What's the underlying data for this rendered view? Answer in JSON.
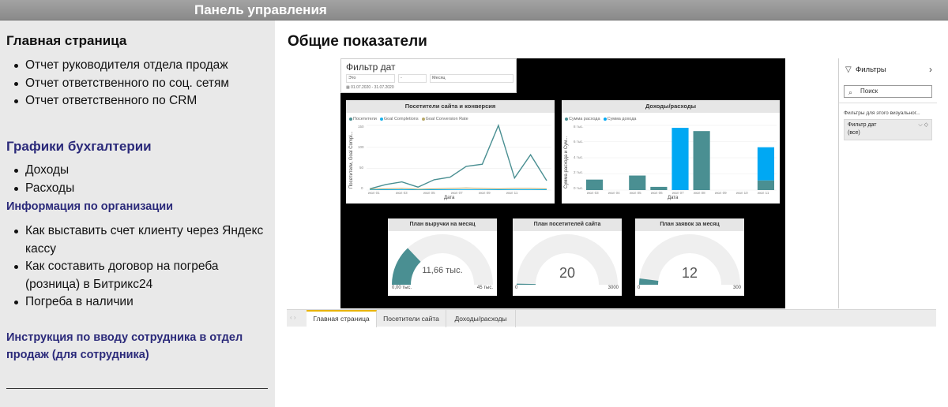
{
  "topbar": {
    "title": "Панель управления"
  },
  "sidebar": {
    "section1": {
      "heading": "Главная страница",
      "items": [
        "Отчет руководителя отдела продаж",
        "Отчет ответственного по соц. сетям",
        "Отчет ответственного по CRM"
      ]
    },
    "section2": {
      "heading": "Графики бухгалтерии",
      "items": [
        "Доходы",
        "Расходы"
      ]
    },
    "section3": {
      "heading": "Информация по организации",
      "items": [
        "Как выставить счет клиенту через Яндекс кассу",
        "Как составить договор на погреба (розница) в Битрикс24",
        "Погреба в наличии"
      ]
    },
    "section4": {
      "heading": "Инструкция по вводу сотрудника в отдел продаж (для сотрудника)"
    }
  },
  "main": {
    "title": "Общие показатели"
  },
  "date_filter": {
    "title": "Фильтр дат",
    "select1": "Это",
    "select2": "-",
    "select3": "Месяц",
    "range": "01.07.2020 - 31.07.2020"
  },
  "chart_visitors": {
    "title": "Посетители сайта и конверсия",
    "legend": [
      "Посетители",
      "Goal Completions",
      "Goal Conversion Rate"
    ],
    "ylabel": "Посетители, Goal Compl...",
    "xlabel": "Дата",
    "yticks": [
      "150",
      "100",
      "50",
      "0"
    ],
    "xticks": [
      "июл 01",
      "июл 03",
      "июл 05",
      "июл 07",
      "июл 09",
      "июл 11"
    ],
    "colors": [
      "#4a8f92",
      "#1ab2ea",
      "#b8a96a"
    ]
  },
  "chart_finance": {
    "title": "Доходы/расходы",
    "legend": [
      "Сумма расхода",
      "Сумма дохода"
    ],
    "ylabel": "Сумма расхода и Сум...",
    "xlabel": "Дата",
    "yticks": [
      "8 тыс.",
      "6 тыс.",
      "4 тыс.",
      "2 тыс.",
      "0 тыс."
    ],
    "xticks": [
      "июл 03",
      "июл 04",
      "июл 05",
      "июл 06",
      "июл 07",
      "июл 08",
      "июл 09",
      "июл 10",
      "июл 11"
    ],
    "colors": [
      "#4a8f92",
      "#00a8f3"
    ]
  },
  "gauges": [
    {
      "title": "План выручки на месяц",
      "value": "11,66 тыс.",
      "min": "0,00 тыс.",
      "max": "45 тыс."
    },
    {
      "title": "План посетителей сайта",
      "value": "20",
      "min": "0",
      "max": "3000"
    },
    {
      "title": "План заявок за месяц",
      "value": "12",
      "min": "0",
      "max": "300"
    }
  ],
  "filters_pane": {
    "title": "Фильтры",
    "search_placeholder": "Поиск",
    "subtitle": "Фильтры для этого визуальног...",
    "card_name": "Фильтр дат",
    "card_value": "(все)"
  },
  "tabs": [
    "Главная страница",
    "Посетители сайта",
    "Доходы/расходы"
  ],
  "chart_data": [
    {
      "type": "line",
      "title": "Посетители сайта и конверсия",
      "xlabel": "Дата",
      "ylabel": "Посетители, Goal Compl...",
      "ylim": [
        0,
        150
      ],
      "x": [
        "июл 01",
        "июл 02",
        "июл 03",
        "июл 04",
        "июл 05",
        "июл 06",
        "июл 07",
        "июл 08",
        "июл 09",
        "июл 10",
        "июл 11",
        "июл 12"
      ],
      "series": [
        {
          "name": "Посетители",
          "values": [
            3,
            13,
            19,
            7,
            24,
            30,
            55,
            60,
            150,
            28,
            82,
            22
          ]
        },
        {
          "name": "Goal Completions",
          "values": [
            1,
            1,
            1,
            1,
            1,
            1,
            1,
            1,
            1,
            1,
            1,
            1
          ]
        },
        {
          "name": "Goal Conversion Rate",
          "values": [
            2,
            3,
            4,
            2,
            3,
            4,
            5,
            4,
            3,
            4,
            4,
            3
          ]
        }
      ]
    },
    {
      "type": "bar",
      "title": "Доходы/расходы",
      "xlabel": "Дата",
      "ylabel": "Сумма расхода и Сум...",
      "ylim": [
        0,
        8000
      ],
      "categories": [
        "июл 03",
        "июл 04",
        "июл 05",
        "июл 06",
        "июл 07",
        "июл 08",
        "июл 09",
        "июл 10",
        "июл 11"
      ],
      "series": [
        {
          "name": "Сумма расхода",
          "values": [
            1300,
            0,
            1800,
            400,
            0,
            7300,
            0,
            0,
            1200
          ]
        },
        {
          "name": "Сумма дохода",
          "values": [
            0,
            0,
            0,
            0,
            7700,
            0,
            0,
            0,
            4100
          ]
        }
      ]
    }
  ],
  "gauge_data": [
    {
      "value": 11660,
      "min": 0,
      "max": 45000
    },
    {
      "value": 20,
      "min": 0,
      "max": 3000
    },
    {
      "value": 12,
      "min": 0,
      "max": 300
    }
  ]
}
